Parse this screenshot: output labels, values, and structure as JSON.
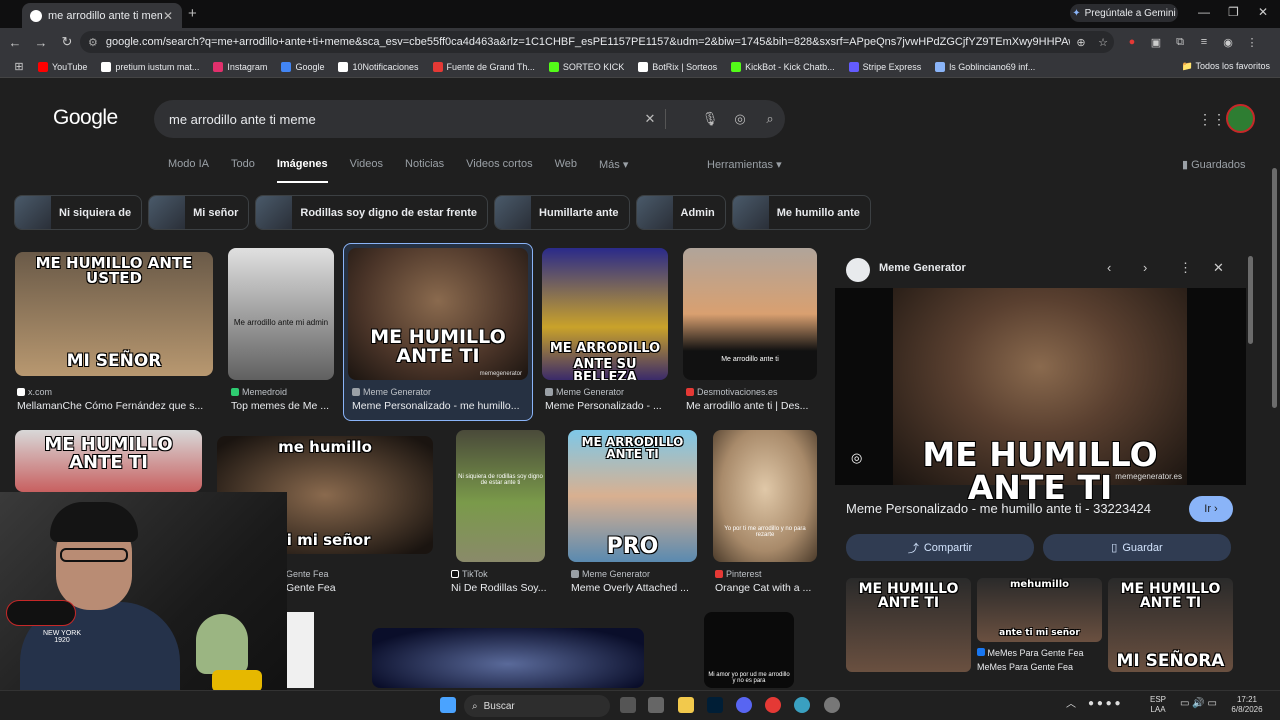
{
  "browser": {
    "tab_title": "me arrodillo ante ti meme - Bu",
    "gemini_label": "Pregúntale a Gemini",
    "url": "google.com/search?q=me+arrodillo+ante+ti+meme&sca_esv=cbe55ff0ca4d463a&rlz=1C1CHBF_esPE1157PE1157&udm=2&biw=1745&bih=828&sxsrf=APpeQns7jvwHPdZGCjfYZ9TEmXwy9HHPAw%3A1786054893483&ei=7Qh1au...",
    "bookmarks": [
      "YouTube",
      "pretium iustum mat...",
      "Instagram",
      "Google",
      "10Notificaciones",
      "Fuente de Grand Th...",
      "SORTEO KICK",
      "BotRix | Sorteos",
      "KickBot - Kick Chatb...",
      "Stripe Express",
      "ls Goblinciano69 inf..."
    ],
    "bookmark_colors": [
      "#ff0000",
      "#ffffff",
      "#e1306c",
      "#4285f4",
      "#ffffff",
      "#e53935",
      "#53fc18",
      "#ffffff",
      "#53fc18",
      "#635bff",
      "#8ab4f8"
    ],
    "all_bookmarks": "Todos los favoritos"
  },
  "google": {
    "logo": "Google",
    "query": "me arrodillo ante ti meme",
    "tabs": [
      "Modo IA",
      "Todo",
      "Imágenes",
      "Videos",
      "Noticias",
      "Videos cortos",
      "Web",
      "Más ▾"
    ],
    "tools": "Herramientas ▾",
    "saved": "Guardados",
    "chips": [
      "Ni siquiera de",
      "Mi señor",
      "Rodillas soy digno de estar frente",
      "Humillarte ante",
      "Admin",
      "Me humillo ante"
    ]
  },
  "results": {
    "row1": [
      {
        "img_text_top": "ME HUMILLO ANTE USTED",
        "img_text_bottom": "MI SEÑOR",
        "source": "x.com",
        "caption": "MellamanChe Cómo Fernández que s..."
      },
      {
        "img_text_top": "Me arrodillo ante mi admin",
        "source": "Memedroid",
        "caption": "Top memes de Me ..."
      },
      {
        "img_text_top": "ME HUMILLO ANTE TI",
        "watermark": "memegenerator",
        "source": "Meme Generator",
        "caption": "Meme Personalizado - me humillo..."
      },
      {
        "img_text_top": "ME ARRODILLO",
        "img_text_bottom": "ANTE SU BELLEZA",
        "source": "Meme Generator",
        "caption": "Meme Personalizado - ..."
      },
      {
        "img_text_top": "Me arrodillo ante ti",
        "source": "Desmotivaciones.es",
        "caption": "Me arrodillo ante ti | Des..."
      }
    ],
    "row2": [
      {
        "img_text_top": "ME HUMILLO ANTE TI"
      },
      {
        "img_text_top": "me humillo",
        "img_text_bottom": "te ti mi señor",
        "source": "Gente Fea",
        "caption": "Gente Fea"
      },
      {
        "img_text_top": "Ni siquiera de rodillas soy digno de estar ante ti",
        "source": "TikTok",
        "caption": "Ni De Rodillas Soy..."
      },
      {
        "img_text_top": "ME ARRODILLO ANTE TI",
        "img_text_bottom": "PRO",
        "source": "Meme Generator",
        "caption": "Meme Overly Attached ..."
      },
      {
        "img_text_top": "Yo por ti me arrodillo y no para rezarte",
        "source": "Pinterest",
        "caption": "Orange Cat with a ..."
      }
    ],
    "row3": [
      {
        "img_text_top": "Mi amor yo por ud me arrodillo y no es para"
      }
    ]
  },
  "panel": {
    "site": "Meme Generator",
    "image_text": "ME HUMILLO ANTE TI",
    "watermark": "memegenerator.es",
    "title": "Meme Personalizado - me humillo ante ti - 33223424",
    "go": "Ir ›",
    "share": "Compartir",
    "save": "Guardar",
    "related": [
      {
        "text": "ME HUMILLO ANTE TI"
      },
      {
        "text": "mehumillo",
        "bottom": "ante ti mi señor",
        "source": "MeMes Para Gente Fea",
        "caption": "MeMes Para Gente Fea"
      },
      {
        "text": "ME HUMILLO ANTE TI",
        "bottom": "MI SEÑORA"
      }
    ]
  },
  "taskbar": {
    "search": "Buscar",
    "lang_top": "ESP",
    "lang_bottom": "LAA",
    "time": "17:21",
    "date": "6/8/2026"
  },
  "webcam": {
    "hat_text": "NEW YORK 1920"
  }
}
